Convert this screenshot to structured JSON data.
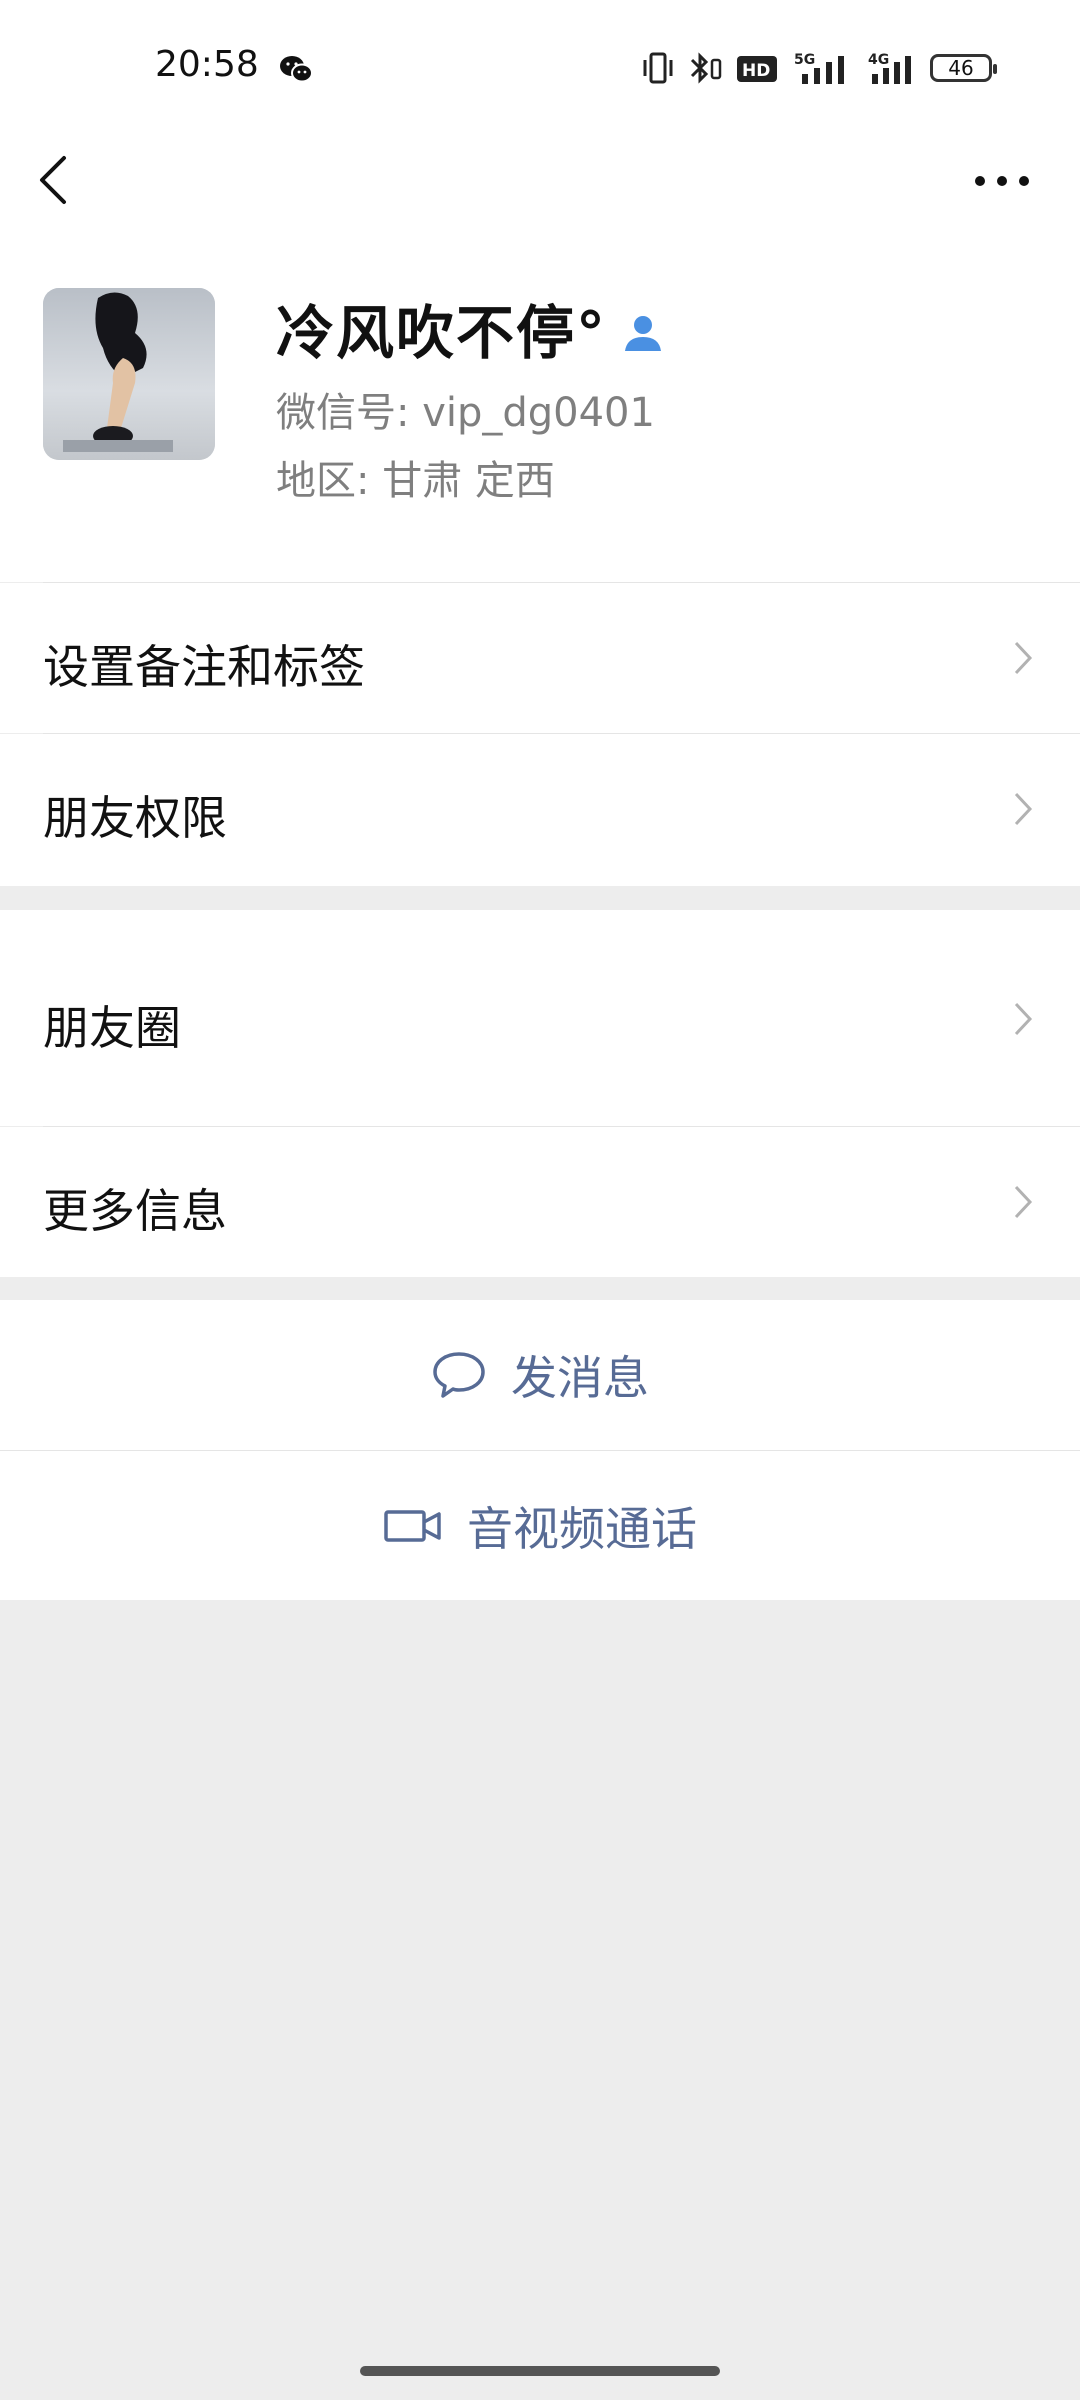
{
  "status_bar": {
    "time": "20:58",
    "battery_level": "46",
    "icons": [
      "wechat-icon",
      "vibrate-icon",
      "bluetooth-icon",
      "hd-icon",
      "signal-5g-icon",
      "signal-4g-icon",
      "battery-icon"
    ]
  },
  "nav": {
    "back_icon": "chevron-left-icon",
    "more_icon": "ellipsis-icon"
  },
  "profile": {
    "name": "冷风吹不停°",
    "wechat_id": "微信号: vip_dg0401",
    "region": "地区: 甘肃  定西"
  },
  "menu": {
    "remark_tags": "设置备注和标签",
    "friend_permissions": "朋友权限",
    "moments": "朋友圈",
    "more_info": "更多信息"
  },
  "actions": {
    "send_message": "发消息",
    "video_call": "音视频通话"
  },
  "colors": {
    "link_blue": "#576b95",
    "background_gray": "#ededed",
    "contact_icon_blue": "#4a90e2"
  }
}
